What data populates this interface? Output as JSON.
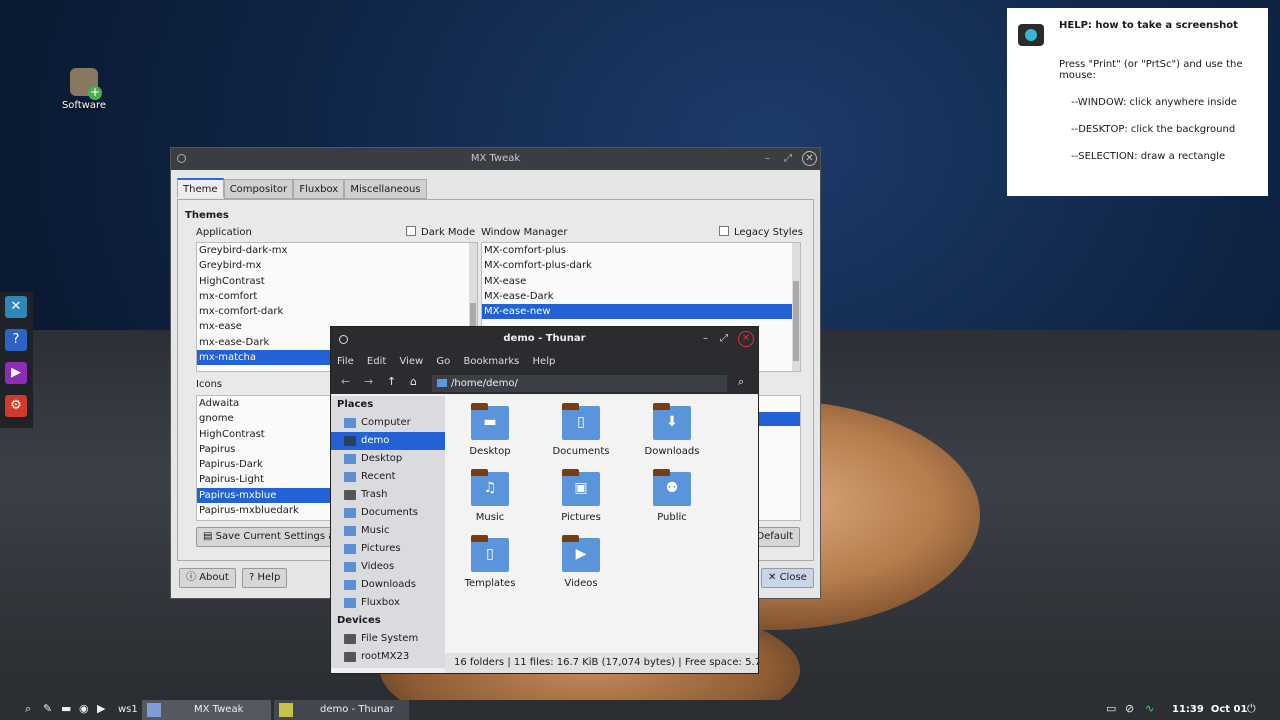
{
  "desktop": {
    "icon_label": "Software"
  },
  "dock": {
    "items": [
      "tools-icon",
      "help-icon",
      "media-icon",
      "settings-icon"
    ]
  },
  "help": {
    "title": "HELP: how to take a screenshot",
    "intro": "Press \"Print\" (or \"PrtSc\") and use the mouse:",
    "line1": "--WINDOW: click anywhere inside",
    "line2": "--DESKTOP: click the background",
    "line3": "--SELECTION: draw a rectangle"
  },
  "tweak": {
    "title": "MX Tweak",
    "tabs": [
      "Theme",
      "Compositor",
      "Fluxbox",
      "Miscellaneous"
    ],
    "themes_heading": "Themes",
    "application_label": "Application",
    "dark_mode_label": "Dark Mode",
    "wm_label": "Window Manager",
    "legacy_label": "Legacy Styles",
    "app_themes": [
      "Greybird-dark-mx",
      "Greybird-mx",
      "HighContrast",
      "mx-comfort",
      "mx-comfort-dark",
      "mx-ease",
      "mx-ease-Dark",
      "mx-matcha"
    ],
    "wm_themes": [
      "MX-comfort-plus",
      "MX-comfort-plus-dark",
      "MX-ease",
      "MX-ease-Dark",
      "MX-ease-new"
    ],
    "icons_label": "Icons",
    "icon_themes": [
      "Adwaita",
      "gnome",
      "HighContrast",
      "Papirus",
      "Papirus-Dark",
      "Papirus-Light",
      "Papirus-mxblue",
      "Papirus-mxbluedark"
    ],
    "save_label": "Save Current Settings as",
    "default_label": "Default",
    "about_label": "About",
    "help_label": "Help",
    "close_label": "Close"
  },
  "thunar": {
    "title": "demo - Thunar",
    "menu": [
      "File",
      "Edit",
      "View",
      "Go",
      "Bookmarks",
      "Help"
    ],
    "path": "/home/demo/",
    "places_heading": "Places",
    "places": [
      "Computer",
      "demo",
      "Desktop",
      "Recent",
      "Trash",
      "Documents",
      "Music",
      "Pictures",
      "Videos",
      "Downloads",
      "Fluxbox"
    ],
    "devices_heading": "Devices",
    "devices": [
      "File System",
      "rootMX23"
    ],
    "folders": [
      "Desktop",
      "Documents",
      "Downloads",
      "Music",
      "Pictures",
      "Public",
      "Templates",
      "Videos"
    ],
    "status": "16 folders  |  11 files: 16.7 KiB (17,074 bytes)  |  Free space: 5.7 ..."
  },
  "taskbar": {
    "workspace": "ws1",
    "tasks": [
      "MX Tweak",
      "demo - Thunar"
    ],
    "time": "11:39",
    "date": "Oct 01"
  }
}
